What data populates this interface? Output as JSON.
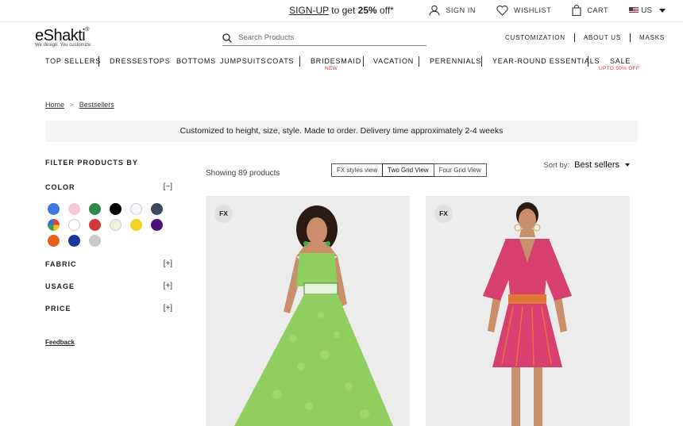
{
  "promo": {
    "signup": "SIGN-UP",
    "text1": " to get ",
    "bold": "25%",
    "text2": " off*"
  },
  "topbar": {
    "sign_in": "SIGN IN",
    "wishlist": "WISHLIST",
    "cart": "CART",
    "country": "US"
  },
  "logo": {
    "wordmark": "eShakti",
    "reg": "®",
    "tagline": "We design. You customize."
  },
  "search": {
    "placeholder": "Search Products"
  },
  "utility_nav": [
    "CUSTOMIZATION",
    "ABOUT US",
    "MASKS"
  ],
  "main_nav": [
    {
      "label": "TOP SELLERS"
    },
    {
      "label": "DRESSES"
    },
    {
      "label": "TOPS"
    },
    {
      "label": "BOTTOMS"
    },
    {
      "label": "JUMPSUITS"
    },
    {
      "label": "COATS"
    },
    {
      "label": "BRIDESMAID",
      "sub": "NEW"
    },
    {
      "label": "VACATION"
    },
    {
      "label": "PERENNIALS"
    },
    {
      "label": "YEAR-ROUND ESSENTIALS"
    },
    {
      "label": "SALE",
      "sub": "UPTO 50% OFF"
    }
  ],
  "breadcrumb": {
    "home": "Home",
    "sep": ">",
    "current": "Bestsellers"
  },
  "notice": "Customized to height, size, style. Made to order. Delivery time approximately 2-4 weeks",
  "filters": {
    "title": "FILTER PRODUCTS BY",
    "color": {
      "label": "COLOR",
      "toggle": "[−]"
    },
    "fabric": {
      "label": "FABRIC",
      "toggle": "[+]"
    },
    "usage": {
      "label": "USAGE",
      "toggle": "[+]"
    },
    "price": {
      "label": "PRICE",
      "toggle": "[+]"
    },
    "swatches": [
      {
        "name": "blue",
        "color": "#3b78d8"
      },
      {
        "name": "pink",
        "color": "#f6c9d8"
      },
      {
        "name": "green",
        "color": "#2e8a4a"
      },
      {
        "name": "black",
        "color": "#000000"
      },
      {
        "name": "off-white",
        "color": "#f4f7fb"
      },
      {
        "name": "charcoal",
        "color": "#3d4a57"
      },
      {
        "name": "multi",
        "color": "multi"
      },
      {
        "name": "white",
        "color": "#ffffff"
      },
      {
        "name": "red",
        "color": "#d2383a"
      },
      {
        "name": "cream",
        "color": "#f1eedb"
      },
      {
        "name": "yellow",
        "color": "#f4d321"
      },
      {
        "name": "purple",
        "color": "#4b1374"
      },
      {
        "name": "orange",
        "color": "#e8601e"
      },
      {
        "name": "navy",
        "color": "#1838a0"
      },
      {
        "name": "grey",
        "color": "#c9c9c9"
      }
    ]
  },
  "feedback": "Feedback",
  "listing": {
    "showing": "Showing 89 products",
    "views": [
      "FX styles view",
      "Two Grid View",
      "Four Grid View"
    ],
    "active_view": "Two Grid View",
    "sort_label": "Sort by:",
    "sort_value": "Best sellers"
  },
  "products": [
    {
      "badge": "FX",
      "dress_color": "#8fcf5f"
    },
    {
      "badge": "FX",
      "dress_color": "#d63f6e"
    }
  ]
}
